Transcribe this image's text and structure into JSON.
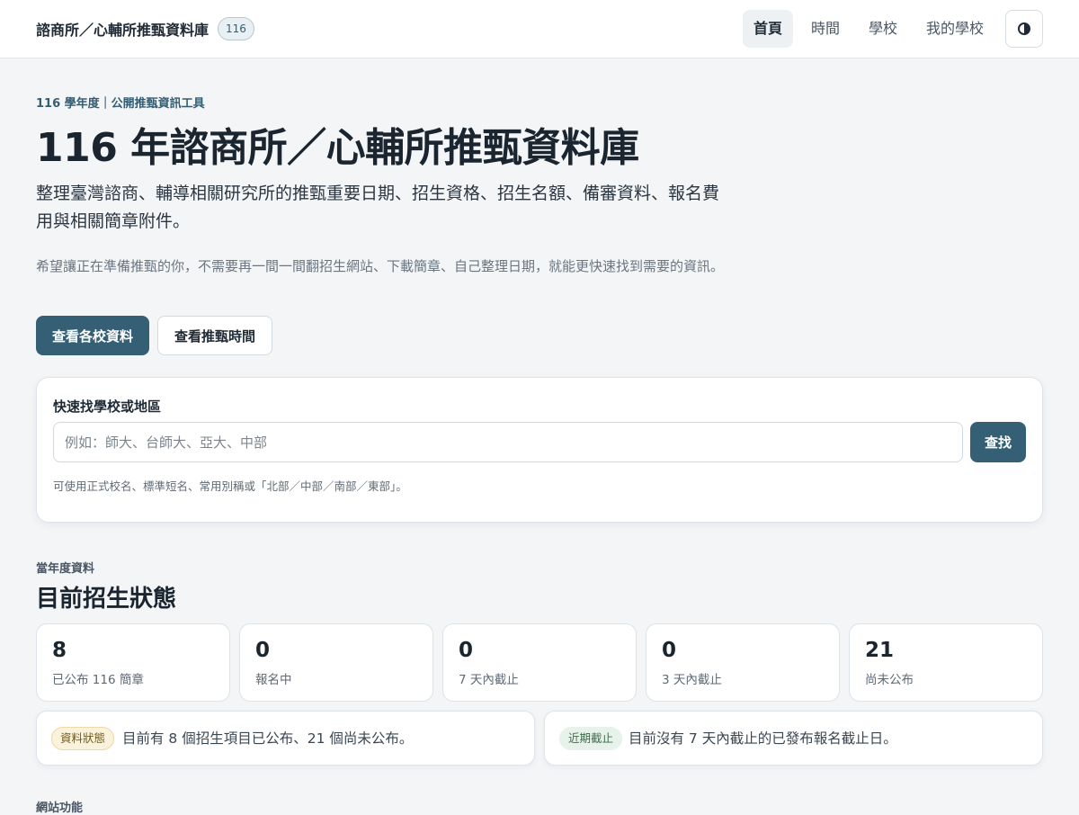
{
  "header": {
    "brand_title": "諮商所／心輔所推甄資料庫",
    "year_badge": "116",
    "nav": [
      {
        "label": "首頁",
        "active": true
      },
      {
        "label": "時間",
        "active": false
      },
      {
        "label": "學校",
        "active": false
      },
      {
        "label": "我的學校",
        "active": false
      }
    ],
    "theme_toggle_icon": "contrast-icon"
  },
  "hero": {
    "eyebrow": "116 學年度｜公開推甄資訊工具",
    "title": "116 年諮商所／心輔所推甄資料庫",
    "lead": "整理臺灣諮商、輔導相關研究所的推甄重要日期、招生資格、招生名額、備審資料、報名費用與相關簡章附件。",
    "sub": "希望讓正在準備推甄的你，不需要再一間一間翻招生網站、下載簡章、自己整理日期，就能更快速找到需要的資訊。",
    "primary_button": "查看各校資料",
    "secondary_button": "查看推甄時間"
  },
  "search": {
    "label": "快速找學校或地區",
    "placeholder": "例如：師大、台師大、亞大、中部",
    "value": "",
    "button": "查找",
    "hint": "可使用正式校名、標準短名、常用別稱或「北部／中部／南部／東部」。"
  },
  "status_section": {
    "eyebrow": "當年度資料",
    "title": "目前招生狀態",
    "stats": [
      {
        "value": "8",
        "label": "已公布 116 簡章"
      },
      {
        "value": "0",
        "label": "報名中"
      },
      {
        "value": "0",
        "label": "7 天內截止"
      },
      {
        "value": "0",
        "label": "3 天內截止"
      },
      {
        "value": "21",
        "label": "尚未公布"
      }
    ],
    "notices": [
      {
        "badge": "資料狀態",
        "text": "目前有 8 個招生項目已公布、21 個尚未公布。"
      },
      {
        "badge": "近期截止",
        "text": "目前沒有 7 天內截止的已發布報名截止日。"
      }
    ]
  },
  "next_section": {
    "eyebrow": "網站功能"
  },
  "colors": {
    "primary": "#345f75",
    "background": "#f3f5f7",
    "badge_amber": "#fbf2dc",
    "badge_green": "#e7f3ea"
  }
}
